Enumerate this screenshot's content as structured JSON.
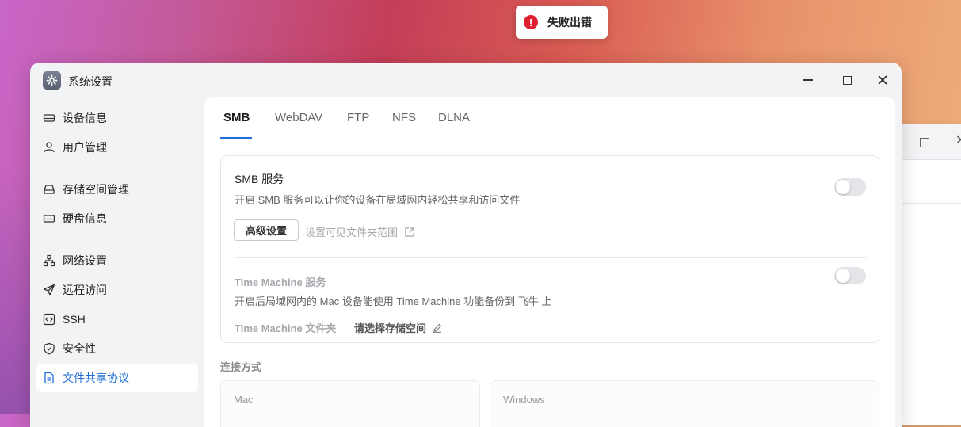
{
  "toast": {
    "icon": "error-icon",
    "icon_glyph": "!",
    "message": "失败出错",
    "color": "#e0202e"
  },
  "window": {
    "title": "系统设置",
    "icon": "settings-gear-icon",
    "controls": [
      "minimize",
      "maximize",
      "close"
    ]
  },
  "sidebar": {
    "items": [
      {
        "label": "设备信息",
        "icon": "drive-icon"
      },
      {
        "label": "用户管理",
        "icon": "user-icon"
      },
      {
        "label": "存储空间管理",
        "icon": "storage-icon"
      },
      {
        "label": "硬盘信息",
        "icon": "disk-icon"
      },
      {
        "label": "网络设置",
        "icon": "network-icon"
      },
      {
        "label": "远程访问",
        "icon": "send-icon"
      },
      {
        "label": "SSH",
        "icon": "code-icon"
      },
      {
        "label": "安全性",
        "icon": "shield-icon"
      },
      {
        "label": "文件共享协议",
        "icon": "document-icon",
        "active": true
      }
    ]
  },
  "tabs": [
    {
      "label": "SMB",
      "active": true
    },
    {
      "label": "WebDAV"
    },
    {
      "label": "FTP"
    },
    {
      "label": "NFS"
    },
    {
      "label": "DLNA"
    }
  ],
  "smb": {
    "title": "SMB 服务",
    "description": "开启 SMB 服务可以让你的设备在局域网内轻松共享和访问文件",
    "enabled": false,
    "advanced_button": "高级设置",
    "scope_link": "设置可见文件夹范围"
  },
  "time_machine": {
    "title": "Time Machine 服务",
    "description": "开启后局域网内的 Mac 设备能使用 Time Machine 功能备份到 飞牛 上",
    "enabled": false,
    "folder_label": "Time Machine 文件夹",
    "folder_value": "请选择存储空间"
  },
  "connection": {
    "label": "连接方式",
    "options": [
      "Mac",
      "Windows"
    ]
  },
  "colors": {
    "accent": "#1f6fd6",
    "toggle_off": "#e4e5e9"
  }
}
